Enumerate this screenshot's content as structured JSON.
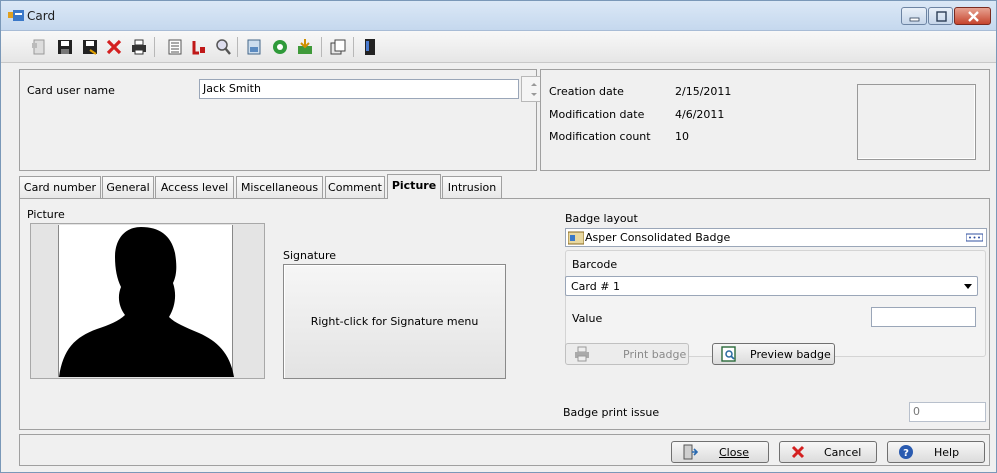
{
  "window": {
    "title": "Card"
  },
  "toolbar": {
    "buttons": [
      "new-icon",
      "save-icon",
      "save-as-icon",
      "delete-icon",
      "print-icon",
      "list-icon",
      "link-icon",
      "search-icon",
      "report-icon",
      "refresh-icon",
      "import-icon",
      "copy-icon",
      "device-icon"
    ]
  },
  "header": {
    "card_user_name_label": "Card user name",
    "card_user_name_value": "Jack Smith",
    "creation_date_label": "Creation date",
    "creation_date_value": "2/15/2011",
    "modification_date_label": "Modification date",
    "modification_date_value": "4/6/2011",
    "modification_count_label": "Modification count",
    "modification_count_value": "10"
  },
  "tabs": [
    {
      "label": "Card number"
    },
    {
      "label": "General"
    },
    {
      "label": "Access level"
    },
    {
      "label": "Miscellaneous"
    },
    {
      "label": "Comment"
    },
    {
      "label": "Picture",
      "active": true
    },
    {
      "label": "Intrusion"
    }
  ],
  "picture_tab": {
    "picture_label": "Picture",
    "signature_label": "Signature",
    "signature_hint": "Right-click for Signature menu",
    "badge_layout_label": "Badge layout",
    "badge_layout_value": "Asper Consolidated Badge",
    "barcode_label": "Barcode",
    "barcode_value": "Card # 1",
    "value_label": "Value",
    "value_value": "",
    "print_badge": "Print badge",
    "preview_badge": "Preview badge",
    "badge_print_issue_label": "Badge print issue",
    "badge_print_issue_value": "0"
  },
  "footer": {
    "close": "Close",
    "cancel": "Cancel",
    "help": "Help"
  },
  "colors": {
    "titlebar": "#c5d8ee",
    "window_bg": "#f0f0f0",
    "close_button": "#c6452e",
    "delete_icon": "#d42020"
  }
}
